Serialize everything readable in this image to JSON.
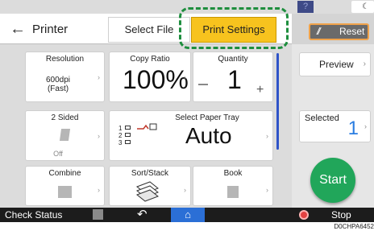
{
  "top_strip": {
    "help_icon_glyph": "?",
    "mode_icon_glyph": "☾"
  },
  "header": {
    "back_glyph": "←",
    "title": "Printer",
    "tab_select_file": "Select File",
    "tab_print_settings": "Print Settings",
    "accent_color": "#f7c31e",
    "highlight_color": "#1e8e3e"
  },
  "right_panel": {
    "reset_glyph": "//",
    "reset_label": "Reset",
    "preview_label": "Preview",
    "chevron_glyph": "›",
    "selected_label": "Selected",
    "selected_value": "1",
    "start_label": "Start",
    "start_color": "#21a65a"
  },
  "settings": {
    "resolution": {
      "label": "Resolution",
      "value_line1": "600dpi",
      "value_line2": "(Fast)"
    },
    "copy_ratio": {
      "label": "Copy Ratio",
      "value": "100%"
    },
    "quantity": {
      "label": "Quantity",
      "value": "1",
      "minus": "−",
      "plus": "+"
    },
    "two_sided": {
      "label": "2 Sided",
      "value": "Off"
    },
    "paper_tray": {
      "label": "Select Paper Tray",
      "value": "Auto",
      "tray_numbers": [
        "1",
        "2",
        "3"
      ]
    },
    "combine": {
      "label": "Combine"
    },
    "sort_stack": {
      "label": "Sort/Stack"
    },
    "book": {
      "label": "Book"
    }
  },
  "bottom_bar": {
    "check_status": "Check Status",
    "undo_glyph": "↶",
    "home_glyph": "⌂",
    "stop_label": "Stop",
    "home_color": "#2b6fd6"
  },
  "figure_code": "D0CHPA6452"
}
